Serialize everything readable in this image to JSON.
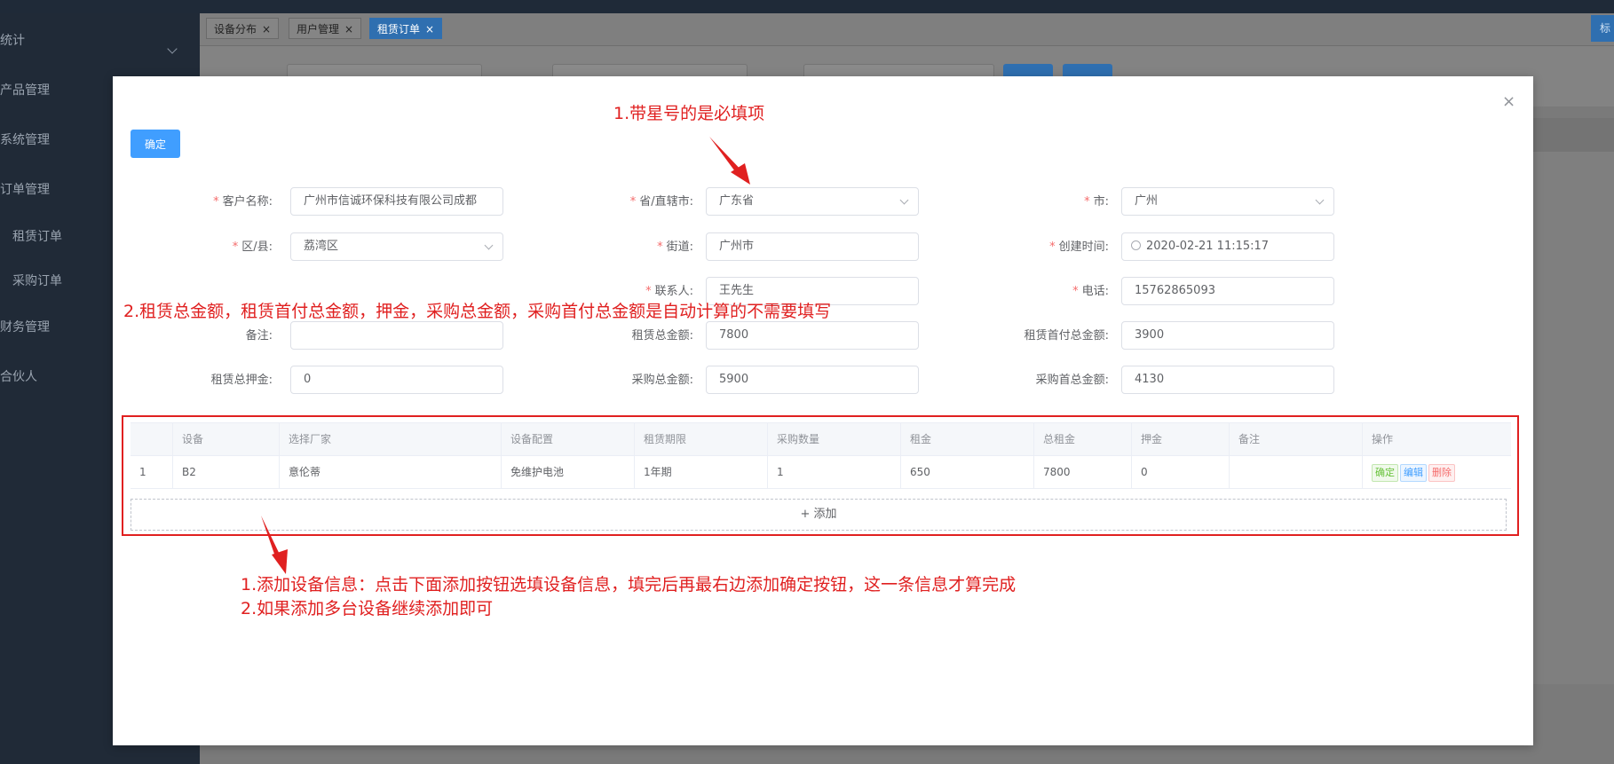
{
  "sidebar": {
    "items": [
      {
        "label": "统计"
      },
      {
        "label": "产品管理"
      },
      {
        "label": "系统管理"
      },
      {
        "label": "订单管理"
      },
      {
        "label": "租赁订单"
      },
      {
        "label": "采购订单"
      },
      {
        "label": "财务管理"
      },
      {
        "label": "合伙人"
      }
    ]
  },
  "tabs": [
    {
      "label": "设备分布",
      "close": "×"
    },
    {
      "label": "用户管理",
      "close": "×"
    },
    {
      "label": "租赁订单",
      "close": "×"
    }
  ],
  "right_tag": "标",
  "modal": {
    "close_icon": "×",
    "confirm_label": "确定",
    "annotations": {
      "required_note": "1.带星号的是必填项",
      "auto_calc_note": "2.租赁总金额，租赁首付总金额，押金，采购总金额，采购首付总金额是自动计算的不需要填写",
      "add_device_note": "1.添加设备信息：点击下面添加按钮选填设备信息，填完后再最右边添加确定按钮，这一条信息才算完成",
      "multi_device_note": "2.如果添加多台设备继续添加即可"
    },
    "form": {
      "customer_name": {
        "label": "客户名称:",
        "value": "广州市信诚环保科技有限公司成都"
      },
      "province": {
        "label": "省/直辖市:",
        "value": "广东省"
      },
      "city": {
        "label": "市:",
        "value": "广州"
      },
      "district": {
        "label": "区/县:",
        "value": "荔湾区"
      },
      "street": {
        "label": "街道:",
        "value": "广州市"
      },
      "created_time": {
        "label": "创建时间:",
        "value": "2020-02-21 11:15:17"
      },
      "contact": {
        "label": "联系人:",
        "value": "王先生"
      },
      "phone": {
        "label": "电话:",
        "value": "15762865093"
      },
      "remark": {
        "label": "备注:",
        "value": ""
      },
      "rent_total": {
        "label": "租赁总金额:",
        "value": "7800"
      },
      "rent_down_total": {
        "label": "租赁首付总金额:",
        "value": "3900"
      },
      "rent_deposit": {
        "label": "租赁总押金:",
        "value": "0"
      },
      "purchase_total": {
        "label": "采购总金额:",
        "value": "5900"
      },
      "purchase_down_total": {
        "label": "采购首总金额:",
        "value": "4130"
      }
    },
    "table": {
      "headers": [
        "",
        "设备",
        "选择厂家",
        "设备配置",
        "租赁期限",
        "采购数量",
        "租金",
        "总租金",
        "押金",
        "备注",
        "操作"
      ],
      "rows": [
        [
          "1",
          "B2",
          "意伦蒂",
          "免维护电池",
          "1年期",
          "1",
          "650",
          "7800",
          "0",
          ""
        ]
      ],
      "actions": {
        "confirm": "确定",
        "edit": "编辑",
        "delete": "删除"
      },
      "add_label": "+ 添加"
    }
  },
  "colors": {
    "primary": "#409eff",
    "annotation": "#e02020",
    "sidebar": "#202a37"
  }
}
